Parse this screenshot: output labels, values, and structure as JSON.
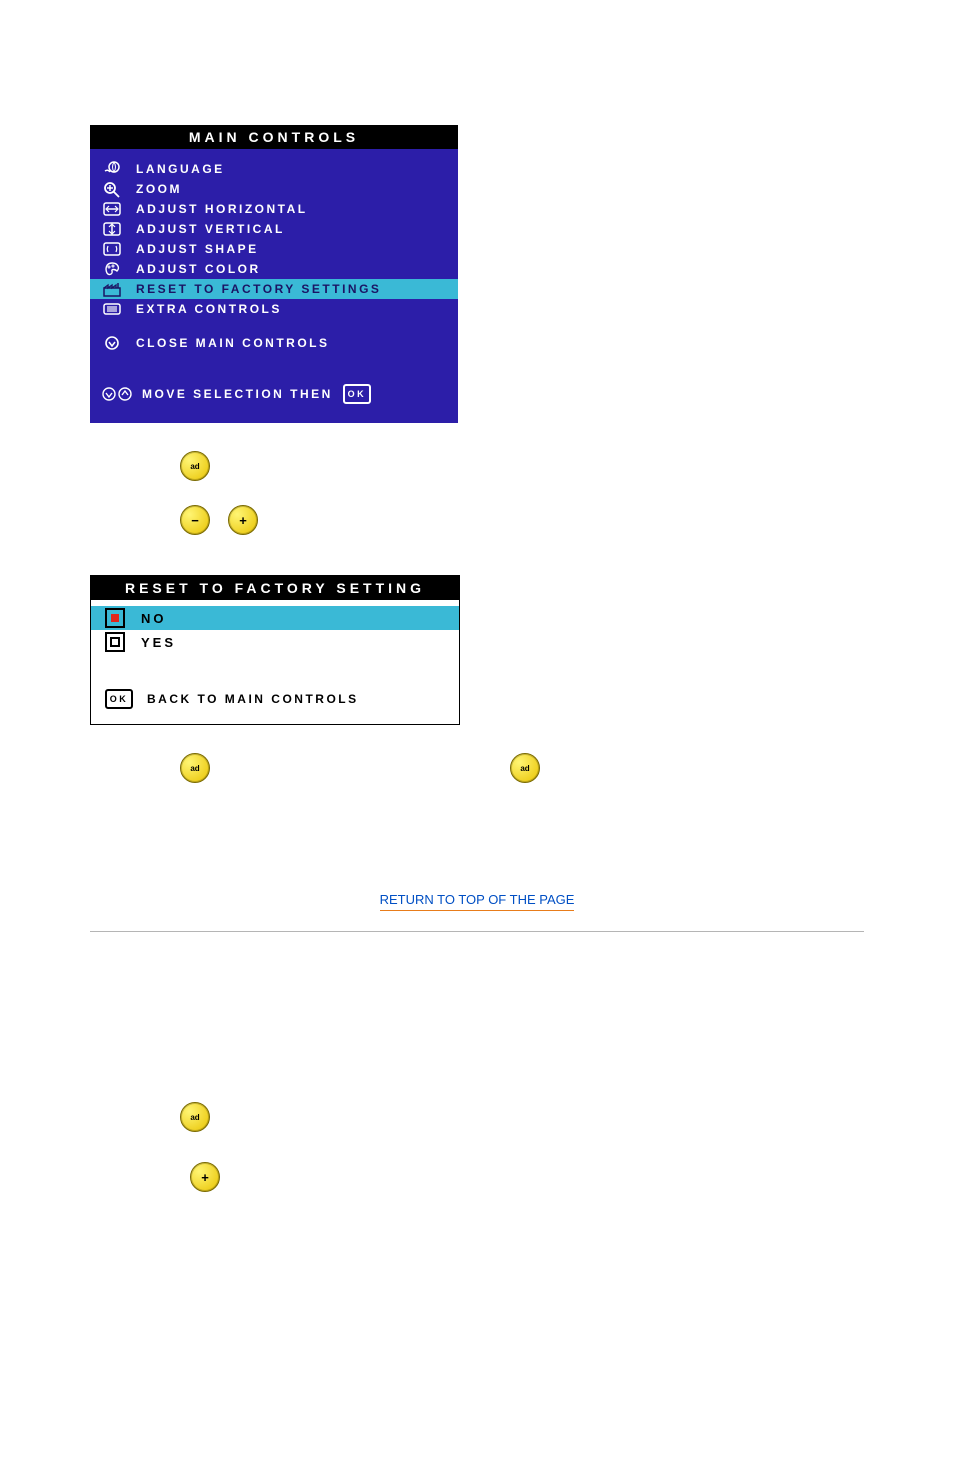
{
  "main_panel": {
    "title": "MAIN CONTROLS",
    "items": [
      {
        "icon": "globe-hand",
        "label": "LANGUAGE"
      },
      {
        "icon": "magnifier",
        "label": "ZOOM"
      },
      {
        "icon": "adjust-h",
        "label": "ADJUST HORIZONTAL"
      },
      {
        "icon": "adjust-v",
        "label": "ADJUST VERTICAL"
      },
      {
        "icon": "adjust-shape",
        "label": "ADJUST SHAPE"
      },
      {
        "icon": "palette",
        "label": "ADJUST COLOR"
      },
      {
        "icon": "factory",
        "label": "RESET TO FACTORY SETTINGS",
        "highlight": true
      },
      {
        "icon": "extra",
        "label": "EXTRA CONTROLS"
      }
    ],
    "close_label": "CLOSE MAIN CONTROLS",
    "hint_label": "MOVE SELECTION THEN",
    "hint_ok": "OK"
  },
  "sub_panel": {
    "title": "RESET TO FACTORY SETTING",
    "options": [
      {
        "label": "NO",
        "selected": true
      },
      {
        "label": "YES",
        "selected": false
      }
    ],
    "back_label": "BACK TO MAIN CONTROLS",
    "back_ok": "OK"
  },
  "buttons": {
    "ok": "ad",
    "minus": "−",
    "plus": "+"
  },
  "link": "RETURN TO TOP OF THE PAGE"
}
